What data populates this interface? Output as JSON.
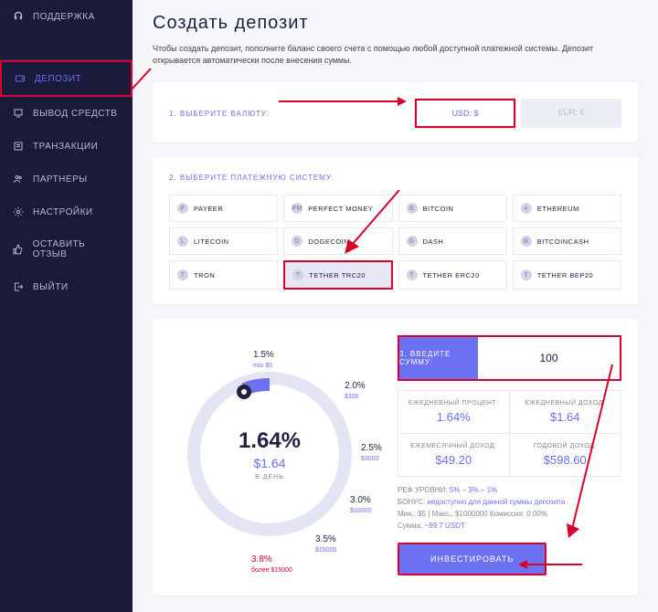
{
  "sidebar": {
    "items": [
      {
        "label": "ПОДДЕРЖКА"
      },
      {
        "label": "ДЕПОЗИТ"
      },
      {
        "label": "ВЫВОД СРЕДСТВ"
      },
      {
        "label": "ТРАНЗАКЦИИ"
      },
      {
        "label": "ПАРТНЕРЫ"
      },
      {
        "label": "НАСТРОЙКИ"
      },
      {
        "label": "ОСТАВИТЬ ОТЗЫВ"
      },
      {
        "label": "ВЫЙТИ"
      }
    ]
  },
  "page": {
    "title": "Создать депозит",
    "desc": "Чтобы создать депозит, пополните баланс своего счета с помощью любой доступной платежной системы. Депозит открывается автоматически после внесения суммы."
  },
  "step1": {
    "label": "1. ВЫБЕРИТЕ ВАЛЮТУ:",
    "usd": "USD: $",
    "eur": "EUR: €"
  },
  "step2": {
    "label": "2. ВЫБЕРИТЕ ПЛАТЕЖНУЮ СИСТЕМУ:",
    "options": [
      "PAYEER",
      "PERFECT MONEY",
      "BITCOIN",
      "ETHEREUM",
      "LITECOIN",
      "DOGECOIN",
      "DASH",
      "BITCOINCASH",
      "TRON",
      "TETHER TRC20",
      "TETHER ERC20",
      "TETHER BEP20"
    ],
    "icons": [
      "P",
      "PM",
      "B",
      "♦",
      "L",
      "D",
      "Ð",
      "B",
      "T",
      "T",
      "T",
      "T"
    ]
  },
  "step3": {
    "label": "3. ВВЕДИТЕ СУММУ:",
    "amount": "100"
  },
  "gauge": {
    "percent": "1.64%",
    "dollar": "$1.64",
    "per_day": "В ДЕНЬ",
    "points": {
      "p15": {
        "v": "1.5%",
        "s": "min $5"
      },
      "p20": {
        "v": "2.0%",
        "s": "$300"
      },
      "p25": {
        "v": "2.5%",
        "s": "$3000"
      },
      "p30": {
        "v": "3.0%",
        "s": "$10000"
      },
      "p35": {
        "v": "3.5%",
        "s": "$15000"
      },
      "p38": {
        "v": "3.8%",
        "s": "более $15000"
      }
    }
  },
  "stats": {
    "daily_pct_t": "ЕЖЕДНЕВНЫЙ ПРОЦЕНТ:",
    "daily_pct_v": "1.64%",
    "daily_inc_t": "ЕЖЕДНЕВНЫЙ ДОХОД:",
    "daily_inc_v": "$1.64",
    "monthly_t": "ЕЖЕМЕСЯЧНЫЙ ДОХОД:",
    "monthly_v": "$49.20",
    "yearly_t": "ГОДОВОЙ ДОХОД:",
    "yearly_v": "$598.60"
  },
  "meta": {
    "ref": "РЕФ.УРОВНИ:",
    "ref_v": "5% – 3% – 1%",
    "bonus": "БОНУС:",
    "bonus_v": "недоступно для данной суммы депозита",
    "limits": "Мин.: $5 | Макс.: $1000000     Комиссия: 0.00%",
    "sum": "Сумма:",
    "sum_v": "~99.7 USDT"
  },
  "buttons": {
    "invest": "ИНВЕСТИРОВАТЬ"
  }
}
